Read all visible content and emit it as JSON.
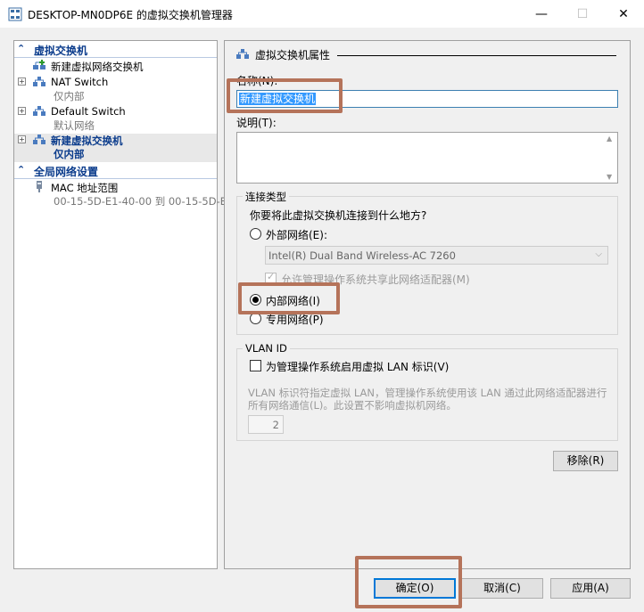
{
  "window": {
    "title": "DESKTOP-MN0DP6E 的虚拟交换机管理器",
    "min_glyph": "—",
    "max_glyph": "☐",
    "close_glyph": "✕"
  },
  "left": {
    "section1": {
      "chev": "⌃",
      "label": "虚拟交换机"
    },
    "new_switch": {
      "label": "新建虚拟网络交换机"
    },
    "items": [
      {
        "plus": "+",
        "name": "NAT Switch",
        "sub": "仅内部"
      },
      {
        "plus": "+",
        "name": "Default Switch",
        "sub": "默认网络"
      },
      {
        "plus": "+",
        "name": "新建虚拟交换机",
        "sub": "仅内部"
      }
    ],
    "section2": {
      "chev": "⌃",
      "label": "全局网络设置"
    },
    "mac": {
      "name": "MAC 地址范围",
      "sub": "00-15-5D-E1-40-00 到 00-15-5D-E..."
    }
  },
  "right": {
    "group_title": "虚拟交换机属性",
    "name_label": "名称(N):",
    "name_value": "新建虚拟交换机",
    "desc_label": "说明(T):",
    "conn": {
      "title": "连接类型",
      "question": "你要将此虚拟交换机连接到什么地方?",
      "external": "外部网络(E):",
      "adapter": "Intel(R) Dual Band Wireless-AC 7260",
      "allow_share": "允许管理操作系统共享此网络适配器(M)",
      "internal": "内部网络(I)",
      "private": "专用网络(P)"
    },
    "vlan": {
      "title": "VLAN ID",
      "enable": "为管理操作系统启用虚拟 LAN 标识(V)",
      "desc_line1": "VLAN 标识符指定虚拟 LAN，管理操作系统使用该 LAN 通过此网络适配器进行",
      "desc_line2": "所有网络通信(L)。此设置不影响虚拟机网络。",
      "value": "2"
    },
    "remove": "移除(R)"
  },
  "buttons": {
    "ok": "确定(O)",
    "cancel": "取消(C)",
    "apply": "应用(A)"
  },
  "colors": {
    "accent": "#0b3c8c",
    "highlight": "#b5735a",
    "selection": "#3399ff"
  }
}
